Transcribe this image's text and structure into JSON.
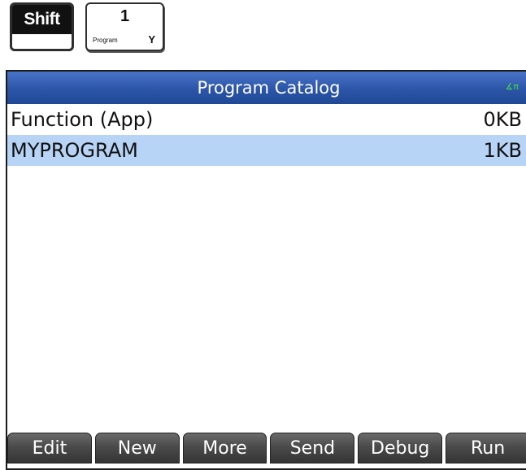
{
  "keys": {
    "shift": "Shift",
    "program_key": {
      "number": "1",
      "label": "Program",
      "alpha": "Y"
    }
  },
  "screen": {
    "title": "Program Catalog",
    "angle_indicator": "∡π",
    "rows": [
      {
        "name": "Function (App)",
        "size": "0KB",
        "selected": false
      },
      {
        "name": "MYPROGRAM",
        "size": "1KB",
        "selected": true
      }
    ],
    "softkeys": [
      "Edit",
      "New",
      "More",
      "Send",
      "Debug",
      "Run"
    ]
  },
  "colors": {
    "title_bar": "#2c55a8",
    "selection": "#b7d3f6",
    "angle_indicator": "#3ddc4a",
    "softkey": "#4b4b4b"
  }
}
